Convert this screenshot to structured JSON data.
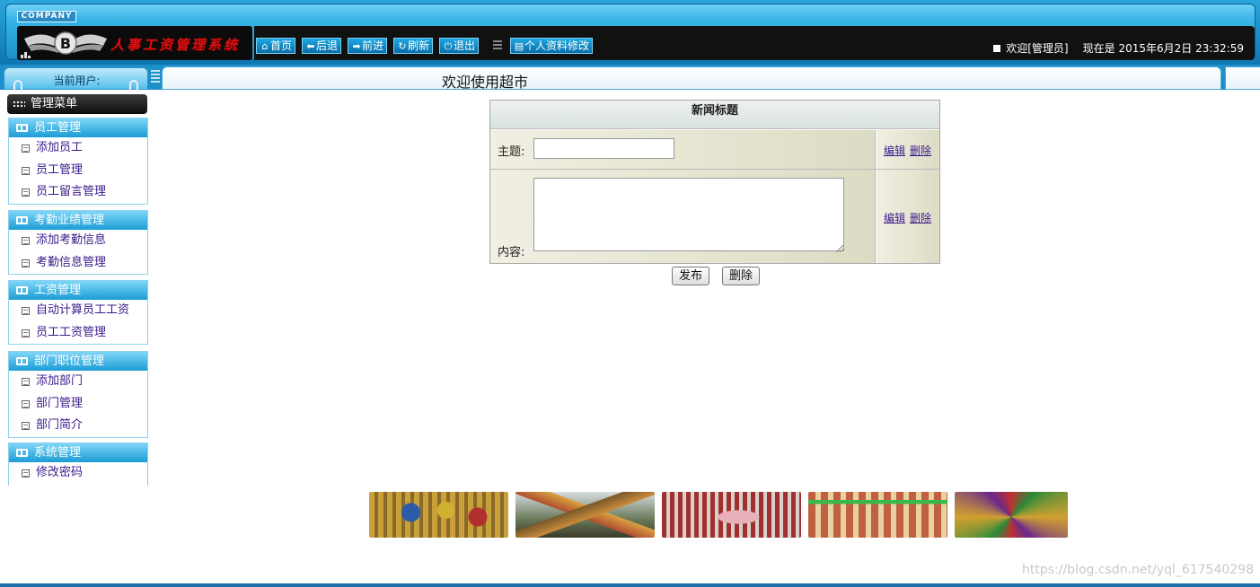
{
  "header": {
    "company_tag": "COMPANY",
    "logo_title": "人事工资管理系统",
    "toolbar": [
      {
        "label": "首页",
        "icon": "home-icon"
      },
      {
        "label": "后退",
        "icon": "arrow-left-icon"
      },
      {
        "label": "前进",
        "icon": "arrow-right-icon"
      },
      {
        "label": "刷新",
        "icon": "refresh-icon"
      },
      {
        "label": "退出",
        "icon": "power-icon"
      }
    ],
    "profile_button": "个人资料修改",
    "welcome_text": "欢迎[管理员]",
    "now_label": "现在是",
    "datetime": "2015年6月2日 23:32:59"
  },
  "subbar": {
    "current_user_label": "当前用户:",
    "page_title": "欢迎使用超市"
  },
  "sidebar": {
    "menu_title": "管理菜单",
    "groups": [
      {
        "title": "员工管理",
        "items": [
          "添加员工",
          "员工管理",
          "员工留言管理"
        ]
      },
      {
        "title": "考勤业绩管理",
        "items": [
          "添加考勤信息",
          "考勤信息管理"
        ]
      },
      {
        "title": "工资管理",
        "items": [
          "自动计算员工工资",
          "员工工资管理"
        ]
      },
      {
        "title": "部门职位管理",
        "items": [
          "添加部门",
          "部门管理",
          "部门简介"
        ]
      },
      {
        "title": "系统管理",
        "items": [
          "修改密码"
        ]
      }
    ]
  },
  "news_form": {
    "header": "新闻标题",
    "subject_label": "主题:",
    "subject_value": "",
    "content_label": "内容:",
    "content_value": "",
    "edit_link": "编辑",
    "delete_link": "删除",
    "publish_button": "发布",
    "delete_button": "删除"
  },
  "gallery": [
    "photo-arcade-display",
    "photo-food-display",
    "photo-fish-display",
    "photo-store-interior",
    "photo-fruit-display"
  ],
  "watermark": "https://blog.csdn.net/yql_617540298",
  "colors": {
    "accent": "#1f8fca",
    "header_dark": "#111111",
    "link": "#3a1a8a",
    "logo_red": "#e01010"
  }
}
